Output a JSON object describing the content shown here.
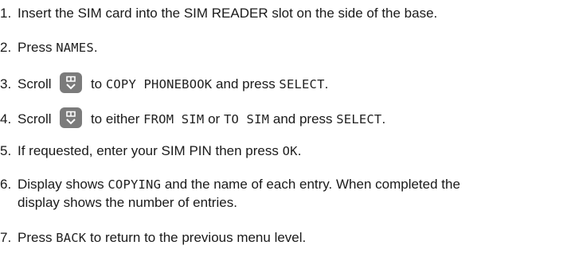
{
  "steps": [
    {
      "number": "1.",
      "text": "Insert the SIM card into the SIM READER slot on the side of the base."
    },
    {
      "number": "2.",
      "pre": "Press ",
      "lcd1": "NAMES",
      "post": "."
    },
    {
      "number": "3.",
      "pre": "Scroll ",
      "icon": "scroll-up-down-key-icon",
      "mid": " to ",
      "lcd1": "COPY PHONEBOOK",
      "mid2": " and press ",
      "lcd2": "SELECT",
      "post": "."
    },
    {
      "number": "4.",
      "pre": "Scroll ",
      "icon": "scroll-up-down-key-icon",
      "mid": " to either ",
      "lcd1": "FROM SIM",
      "mid2": " or ",
      "lcd2": "TO SIM",
      "mid3": " and press ",
      "lcd3": "SELECT",
      "post": "."
    },
    {
      "number": "5.",
      "pre": "If requested, enter your SIM PIN then press ",
      "lcd1": "OK",
      "post": "."
    },
    {
      "number": "6.",
      "pre": "Display shows ",
      "lcd1": "COPYING",
      "post": " and the name of each entry. When completed the",
      "line2": "display shows the number of entries."
    },
    {
      "number": "7.",
      "pre": "Press ",
      "lcd1": "BACK",
      "post": " to return to the previous menu level."
    }
  ],
  "colors": {
    "text": "#1a1a1a",
    "key_background": "#7b7b7b",
    "key_glyph": "#ffffff"
  }
}
